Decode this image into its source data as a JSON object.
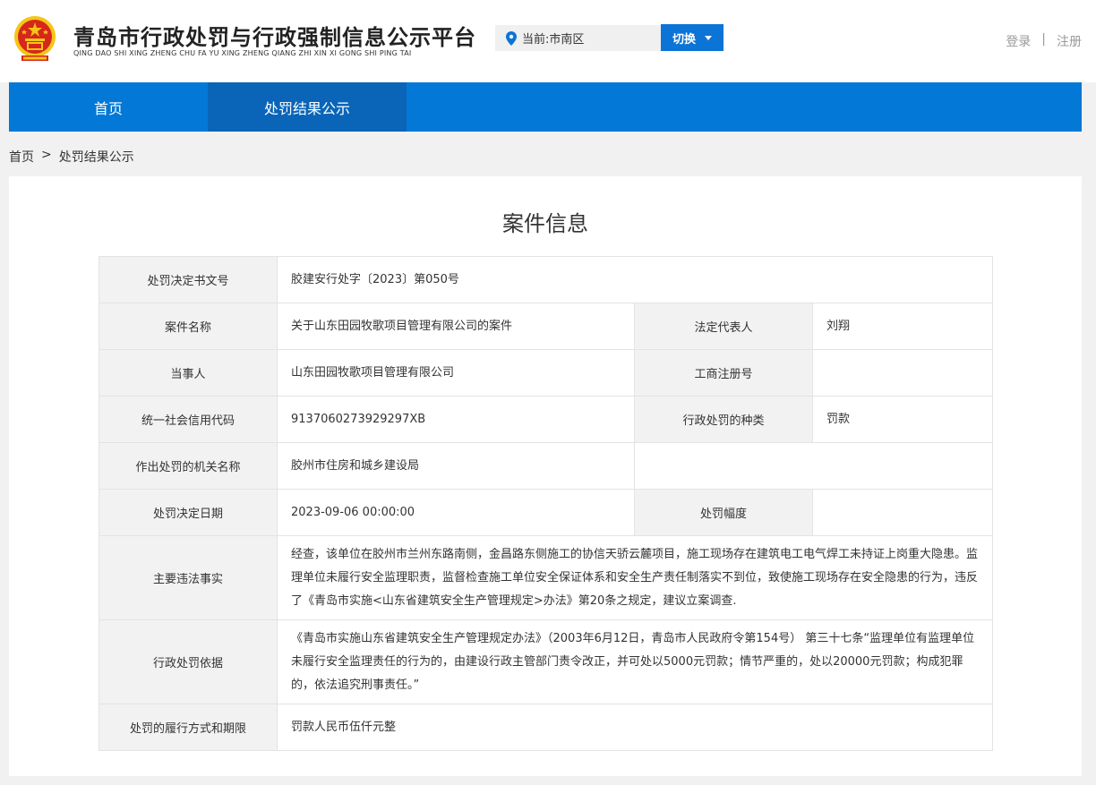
{
  "header": {
    "title": "青岛市行政处罚与行政强制信息公示平台",
    "subtitle": "QING DAO SHI XING ZHENG CHU FA YU XING ZHENG QIANG ZHI XIN XI GONG SHI PING TAI",
    "location_label": "当前:市南区",
    "switch_label": "切换",
    "login_label": "登录",
    "separator": "|",
    "register_label": "注册"
  },
  "nav": {
    "items": [
      {
        "label": "首页"
      },
      {
        "label": "处罚结果公示"
      }
    ]
  },
  "breadcrumb": {
    "home": "首页",
    "sep": ">",
    "current": "处罚结果公示"
  },
  "case": {
    "title": "案件信息",
    "rows": {
      "doc_no": {
        "label": "处罚决定书文号",
        "value": "胶建安行处字〔2023〕第050号"
      },
      "case_name": {
        "label": "案件名称",
        "value": "关于山东田园牧歌项目管理有限公司的案件"
      },
      "legal_rep": {
        "label": "法定代表人",
        "value": "刘翔"
      },
      "party": {
        "label": "当事人",
        "value": "山东田园牧歌项目管理有限公司"
      },
      "reg_no": {
        "label": "工商注册号",
        "value": ""
      },
      "credit_code": {
        "label": "统一社会信用代码",
        "value": "9137060273929297XB"
      },
      "penalty_type": {
        "label": "行政处罚的种类",
        "value": "罚款"
      },
      "authority": {
        "label": "作出处罚的机关名称",
        "value": "胶州市住房和城乡建设局"
      },
      "decision_date": {
        "label": "处罚决定日期",
        "value": "2023-09-06 00:00:00"
      },
      "penalty_range": {
        "label": "处罚幅度",
        "value": ""
      },
      "facts": {
        "label": "主要违法事实",
        "value": "经查，该单位在胶州市兰州东路南侧，金昌路东侧施工的协信天骄云麓项目，施工现场存在建筑电工电气焊工未持证上岗重大隐患。监理单位未履行安全监理职责，监督检查施工单位安全保证体系和安全生产责任制落实不到位，致使施工现场存在安全隐患的行为，违反了《青岛市实施<山东省建筑安全生产管理规定>办法》第20条之规定，建议立案调查."
      },
      "basis": {
        "label": "行政处罚依据",
        "value": "《青岛市实施山东省建筑安全生产管理规定办法》（2003年6月12日，青岛市人民政府令第154号） 第三十七条“监理单位有监理单位未履行安全监理责任的行为的，由建设行政主管部门责令改正，并可处以5000元罚款；情节严重的，处以20000元罚款；构成犯罪的，依法追究刑事责任。”"
      },
      "performance": {
        "label": "处罚的履行方式和期限",
        "value": "罚款人民币伍仟元整"
      }
    }
  },
  "colors": {
    "nav_blue": "#0478d6",
    "nav_active": "#0a65b8",
    "switch_blue": "#0b74d6",
    "emblem_red": "#d7261b",
    "emblem_gold": "#f5c518"
  }
}
